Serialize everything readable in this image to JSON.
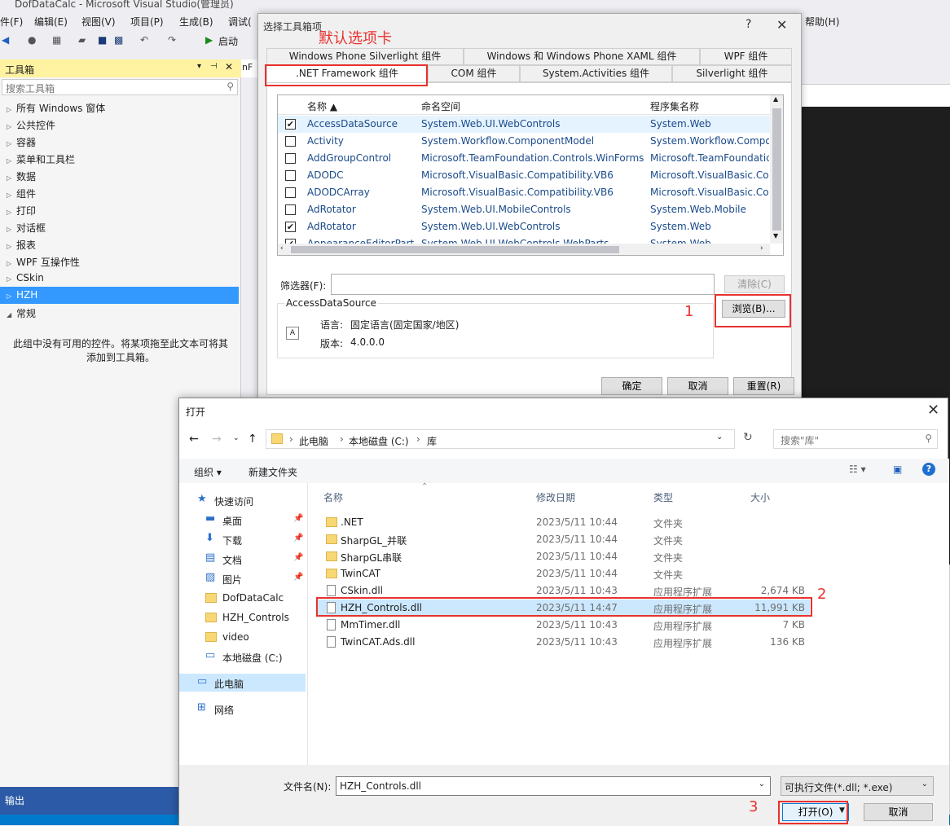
{
  "vs": {
    "title": "DofDataCalc - Microsoft Visual Studio(管理员)",
    "menu": [
      "件(F)",
      "编辑(E)",
      "视图(V)",
      "项目(P)",
      "生成(B)",
      "调试(",
      "帮助(H)"
    ],
    "start_label": "启动",
    "doc_tab": "nF",
    "output_label": "输出"
  },
  "toolbox": {
    "title": "工具箱",
    "pin": "▾ ‒ᵃ",
    "search_placeholder": "搜索工具箱",
    "items": [
      {
        "label": "所有 Windows 窗体",
        "expanded": false
      },
      {
        "label": "公共控件",
        "expanded": false
      },
      {
        "label": "容器",
        "expanded": false
      },
      {
        "label": "菜单和工具栏",
        "expanded": false
      },
      {
        "label": "数据",
        "expanded": false
      },
      {
        "label": "组件",
        "expanded": false
      },
      {
        "label": "打印",
        "expanded": false
      },
      {
        "label": "对话框",
        "expanded": false
      },
      {
        "label": "报表",
        "expanded": false
      },
      {
        "label": "WPF 互操作性",
        "expanded": false
      },
      {
        "label": "CSkin",
        "expanded": false
      },
      {
        "label": "HZH",
        "expanded": false,
        "selected": true
      },
      {
        "label": "常规",
        "expanded": true
      }
    ],
    "empty_text_1": "此组中没有可用的控件。将某项拖至此文本可将其",
    "empty_text_2": "添加到工具箱。"
  },
  "choose_dialog": {
    "title": "选择工具箱项",
    "help": "?",
    "close": "✕",
    "annotation_tab": "默认选项卡",
    "tabs_row1": [
      "Windows Phone Silverlight 组件",
      "Windows 和 Windows Phone XAML 组件",
      "WPF 组件"
    ],
    "tabs_row2": [
      ".NET Framework 组件",
      "COM 组件",
      "System.Activities 组件",
      "Silverlight 组件"
    ],
    "columns": {
      "name": "名称 ▲",
      "namespace": "命名空间",
      "assembly": "程序集名称"
    },
    "rows": [
      {
        "checked": true,
        "name": "AccessDataSource",
        "ns": "System.Web.UI.WebControls",
        "asm": "System.Web",
        "selected": true
      },
      {
        "checked": false,
        "name": "Activity",
        "ns": "System.Workflow.ComponentModel",
        "asm": "System.Workflow.Compo"
      },
      {
        "checked": false,
        "name": "AddGroupControl",
        "ns": "Microsoft.TeamFoundation.Controls.WinForms",
        "asm": "Microsoft.TeamFoundatic"
      },
      {
        "checked": false,
        "name": "ADODC",
        "ns": "Microsoft.VisualBasic.Compatibility.VB6",
        "asm": "Microsoft.VisualBasic.Cor"
      },
      {
        "checked": false,
        "name": "ADODCArray",
        "ns": "Microsoft.VisualBasic.Compatibility.VB6",
        "asm": "Microsoft.VisualBasic.Cor"
      },
      {
        "checked": false,
        "name": "AdRotator",
        "ns": "System.Web.UI.MobileControls",
        "asm": "System.Web.Mobile"
      },
      {
        "checked": true,
        "name": "AdRotator",
        "ns": "System.Web.UI.WebControls",
        "asm": "System.Web"
      },
      {
        "checked": true,
        "name": "AppearanceEditorPart",
        "ns": "System.Web.UI.WebControls.WebParts",
        "asm": "System.Web"
      }
    ],
    "filter_label": "筛选器(F):",
    "filter_value": "",
    "clear_button": "清除(C)",
    "browse_button": "浏览(B)...",
    "annotation_1": "1",
    "group_title": "AccessDataSource",
    "lang_label": "语言:",
    "lang_value": "固定语言(固定国家/地区)",
    "version_label": "版本:",
    "version_value": "4.0.0.0",
    "ok_button": "确定",
    "cancel_button": "取消",
    "reset_button": "重置(R)"
  },
  "open_dialog": {
    "title": "打开",
    "close": "✕",
    "breadcrumb": [
      "此电脑",
      "本地磁盘 (C:)",
      "库"
    ],
    "search_placeholder": "搜索\"库\"",
    "organize": "组织 ▾",
    "new_folder": "新建文件夹",
    "nav": [
      {
        "label": "快速访问",
        "icon": "star-icon",
        "indent": false
      },
      {
        "label": "桌面",
        "icon": "desktop-icon",
        "pinned": true
      },
      {
        "label": "下载",
        "icon": "download-icon",
        "pinned": true
      },
      {
        "label": "文档",
        "icon": "document-icon",
        "pinned": true
      },
      {
        "label": "图片",
        "icon": "picture-icon",
        "pinned": true
      },
      {
        "label": "DofDataCalc",
        "icon": "folder-icon"
      },
      {
        "label": "HZH_Controls",
        "icon": "folder-icon"
      },
      {
        "label": "video",
        "icon": "folder-icon"
      },
      {
        "label": "本地磁盘 (C:)",
        "icon": "drive-icon"
      },
      {
        "label": "此电脑",
        "icon": "computer-icon",
        "selected": true
      },
      {
        "label": "网络",
        "icon": "network-icon"
      }
    ],
    "columns": {
      "name": "名称",
      "date": "修改日期",
      "type": "类型",
      "size": "大小"
    },
    "files": [
      {
        "name": ".NET",
        "date": "2023/5/11 10:44",
        "type": "文件夹",
        "size": "",
        "folder": true
      },
      {
        "name": "SharpGL_并联",
        "date": "2023/5/11 10:44",
        "type": "文件夹",
        "size": "",
        "folder": true
      },
      {
        "name": "SharpGL串联",
        "date": "2023/5/11 10:44",
        "type": "文件夹",
        "size": "",
        "folder": true
      },
      {
        "name": "TwinCAT",
        "date": "2023/5/11 10:44",
        "type": "文件夹",
        "size": "",
        "folder": true
      },
      {
        "name": "CSkin.dll",
        "date": "2023/5/11 10:43",
        "type": "应用程序扩展",
        "size": "2,674 KB",
        "folder": false
      },
      {
        "name": "HZH_Controls.dll",
        "date": "2023/5/11 14:47",
        "type": "应用程序扩展",
        "size": "11,991 KB",
        "folder": false,
        "selected": true
      },
      {
        "name": "MmTimer.dll",
        "date": "2023/5/11 10:43",
        "type": "应用程序扩展",
        "size": "7 KB",
        "folder": false
      },
      {
        "name": "TwinCAT.Ads.dll",
        "date": "2023/5/11 10:43",
        "type": "应用程序扩展",
        "size": "136 KB",
        "folder": false
      }
    ],
    "annotation_2": "2",
    "filename_label": "文件名(N):",
    "filename_value": "HZH_Controls.dll",
    "filetype_value": "可执行文件(*.dll; *.exe)",
    "open_button": "打开(O)",
    "cancel_button": "取消",
    "annotation_3": "3"
  },
  "colors": {
    "accent": "#3399ff",
    "annotation": "#e8322f",
    "statusbar": "#007acc"
  }
}
